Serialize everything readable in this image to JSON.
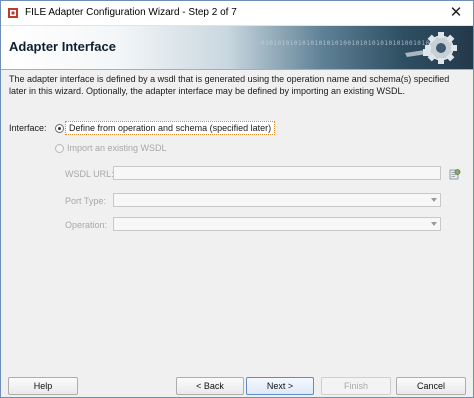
{
  "window": {
    "title": "FILE Adapter Configuration Wizard - Step 2 of 7"
  },
  "banner": {
    "title": "Adapter Interface",
    "binary_text": "0101010101010101010100101010101010100101010"
  },
  "description": "The adapter interface is defined by a wsdl that is generated using the operation name and schema(s) specified later in this wizard.  Optionally, the adapter interface may be defined by importing an existing WSDL.",
  "interface": {
    "label": "Interface:",
    "options": [
      {
        "label": "Define from operation and schema (specified later)",
        "selected": true,
        "enabled": true
      },
      {
        "label": "Import an existing WSDL",
        "selected": false,
        "enabled": false
      }
    ]
  },
  "fields": {
    "wsdl_url": {
      "label": "WSDL URL:",
      "value": ""
    },
    "port_type": {
      "label": "Port Type:",
      "value": ""
    },
    "operation": {
      "label": "Operation:",
      "value": ""
    }
  },
  "buttons": {
    "help": "Help",
    "back": "< Back",
    "next": "Next >",
    "finish": "Finish",
    "cancel": "Cancel"
  },
  "icons": {
    "close": "close-icon",
    "app": "adapter-app-icon",
    "banner": "gear-plug-icon",
    "browse": "browse-wsdl-icon"
  },
  "colors": {
    "focus_outline": "#e08a2b",
    "banner_dark": "#24394a",
    "window_border": "#6d8fb5"
  }
}
